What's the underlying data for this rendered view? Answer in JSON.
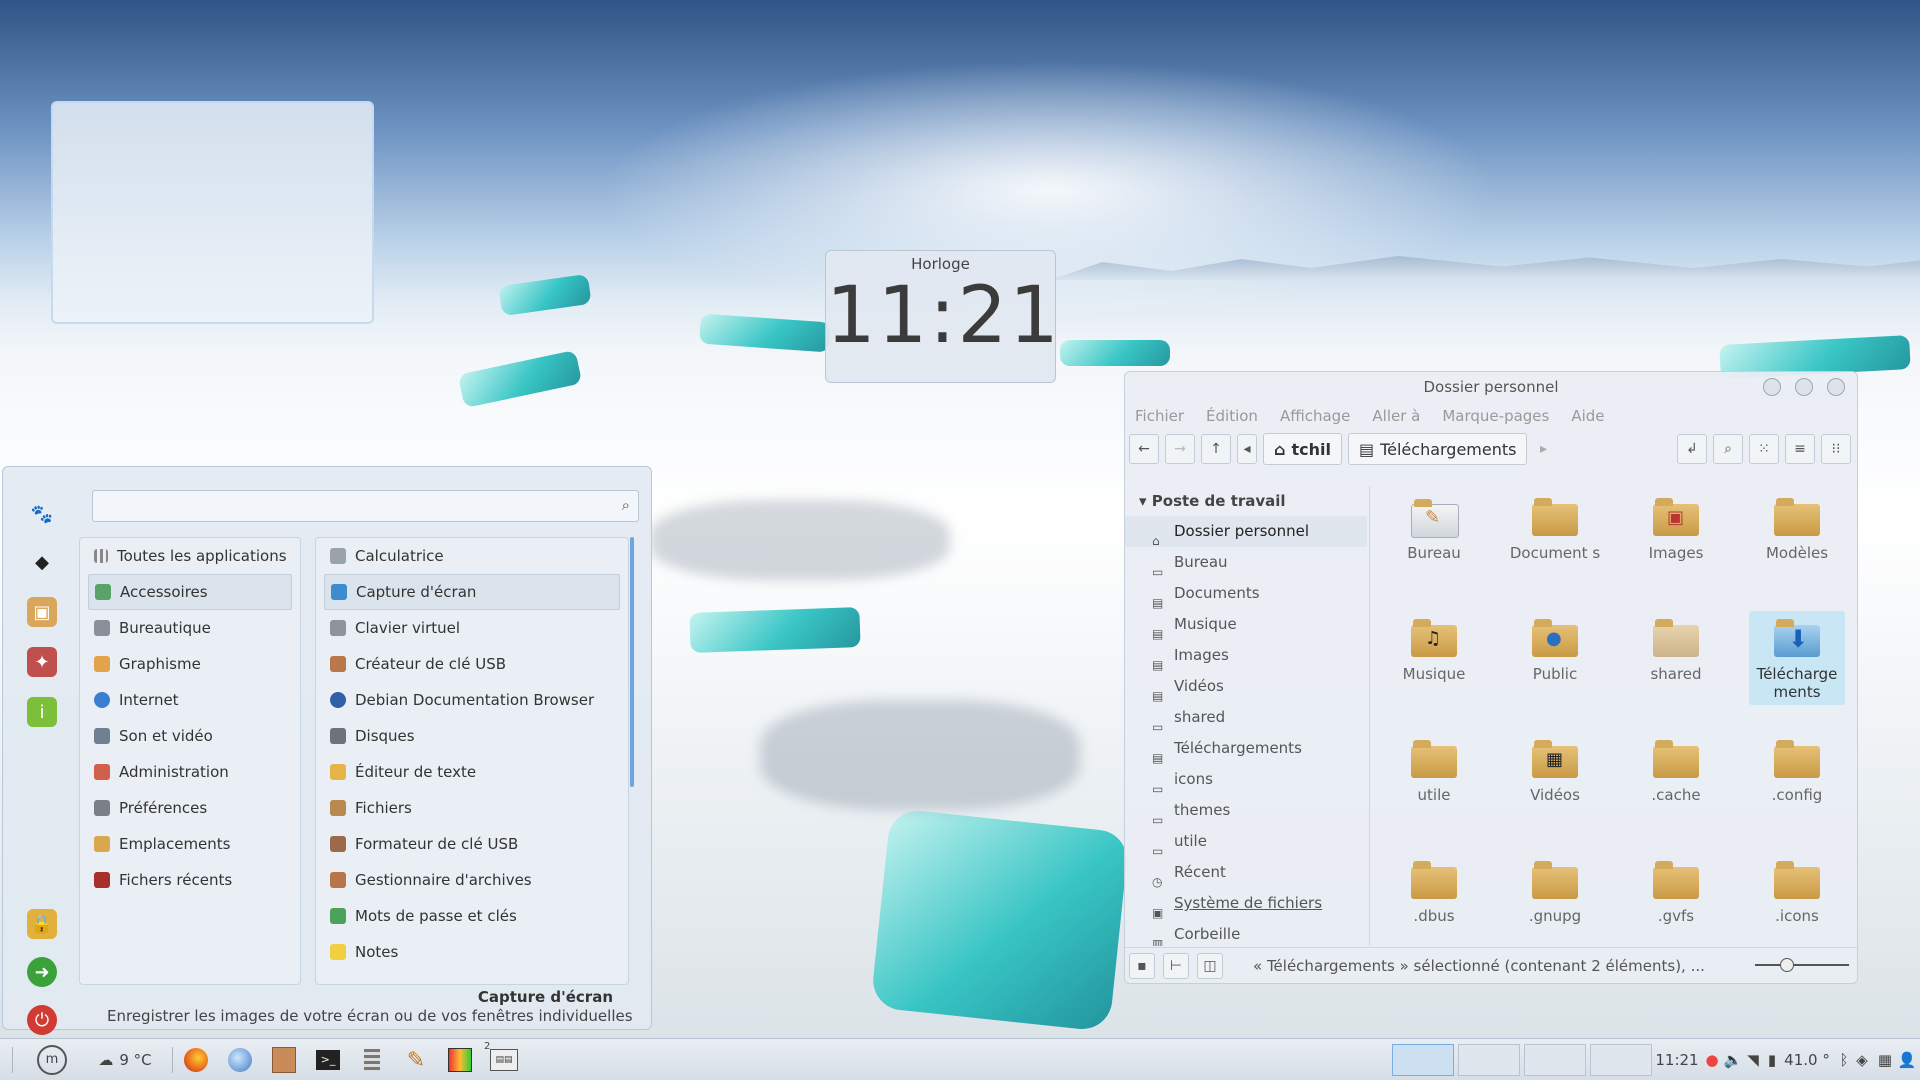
{
  "clock_desklet": {
    "title": "Horloge",
    "time": "11:21"
  },
  "file_manager": {
    "title": "Dossier personnel",
    "menu": [
      "Fichier",
      "Édition",
      "Affichage",
      "Aller à",
      "Marque-pages",
      "Aide"
    ],
    "path": [
      "tchil",
      "Téléchargements"
    ],
    "sidebar_header": "Poste de travail",
    "sidebar": [
      "Dossier personnel",
      "Bureau",
      "Documents",
      "Musique",
      "Images",
      "Vidéos",
      "shared",
      "Téléchargements",
      "icons",
      "themes",
      "utile",
      "Récent",
      "Système de fichiers",
      "Corbeille"
    ],
    "items": [
      "Bureau",
      "Document s",
      "Images",
      "Modèles",
      "Musique",
      "Public",
      "shared",
      "Télécharge ments",
      "utile",
      "Vidéos",
      ".cache",
      ".config",
      ".dbus",
      ".gnupg",
      ".gvfs",
      ".icons"
    ],
    "selected_item": "Télécharge ments",
    "status": "« Téléchargements » sélectionné (contenant 2 éléments), ...",
    "zoom_level": 0.3
  },
  "menu": {
    "categories": [
      "Toutes les applications",
      "Accessoires",
      "Bureautique",
      "Graphisme",
      "Internet",
      "Son et vidéo",
      "Administration",
      "Préférences",
      "Emplacements",
      "Fichers récents"
    ],
    "selected_category": "Accessoires",
    "apps": [
      "Calculatrice",
      "Capture d'écran",
      "Clavier virtuel",
      "Créateur de clé USB",
      "Debian Documentation Browser",
      "Disques",
      "Éditeur de texte",
      "Fichiers",
      "Formateur de clé USB",
      "Gestionnaire d'archives",
      "Mots de passe et clés",
      "Notes"
    ],
    "selected_app": "Capture d'écran",
    "desc_title": "Capture d'écran",
    "desc_text": "Enregistrer les images de votre écran ou de vos fenêtres individuelles"
  },
  "taskbar": {
    "weather": "9 °C",
    "time": "11:21",
    "temperature": "41.0 °",
    "badge": "2"
  }
}
